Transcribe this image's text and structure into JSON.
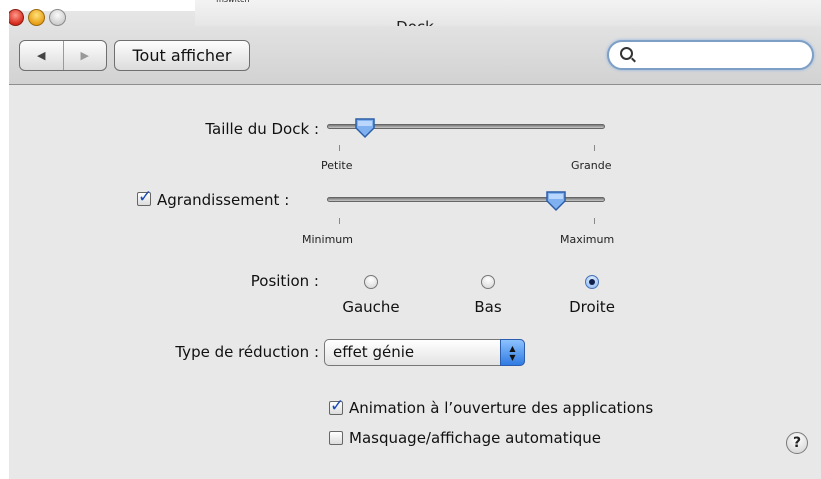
{
  "window": {
    "title": "Dock",
    "menu_snippet": "fnswitch"
  },
  "toolbar": {
    "back_label": "◀",
    "forward_label": "▶",
    "show_all_label": "Tout afficher",
    "search_placeholder": ""
  },
  "dock_size": {
    "label": "Taille du Dock :",
    "min_label": "Petite",
    "max_label": "Grande",
    "level": 0.1
  },
  "magnification": {
    "label": "Agrandissement :",
    "checked": true,
    "min_label": "Minimum",
    "max_label": "Maximum",
    "level": 0.85
  },
  "position": {
    "label": "Position :",
    "options": [
      {
        "label": "Gauche",
        "selected": false
      },
      {
        "label": "Bas",
        "selected": false
      },
      {
        "label": "Droite",
        "selected": true
      }
    ]
  },
  "minimize_effect": {
    "label": "Type de réduction :",
    "value": "effet génie"
  },
  "checkboxes": [
    {
      "label": "Animation à l’ouverture des applications",
      "checked": true
    },
    {
      "label": "Masquage/affichage automatique",
      "checked": false
    }
  ],
  "help_label": "?",
  "colors": {
    "accent": "#2f7be3",
    "checkmark": "#1a49b7",
    "pane": "#e8e8e8"
  }
}
